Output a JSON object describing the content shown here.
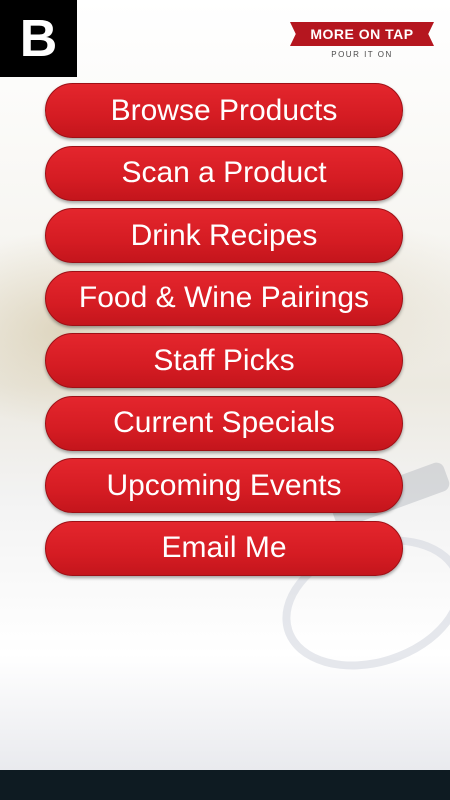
{
  "brand": {
    "badge_letter": "B"
  },
  "logo": {
    "title": "MORE ON TAP",
    "tagline": "POUR IT ON",
    "accent_color": "#b5161f"
  },
  "menu": {
    "button_color": "#d51c23",
    "items": [
      {
        "label": "Browse Products"
      },
      {
        "label": "Scan a Product"
      },
      {
        "label": "Drink Recipes"
      },
      {
        "label": "Food & Wine Pairings"
      },
      {
        "label": "Staff Picks"
      },
      {
        "label": "Current Specials"
      },
      {
        "label": "Upcoming Events"
      },
      {
        "label": "Email Me"
      }
    ]
  }
}
